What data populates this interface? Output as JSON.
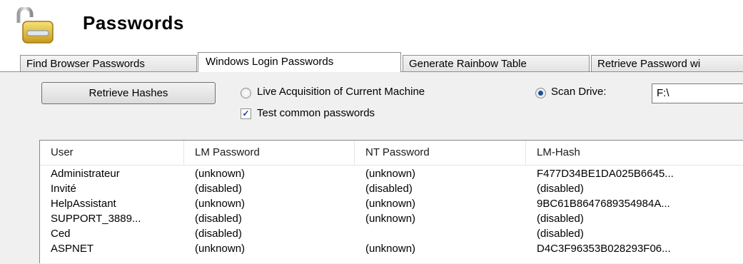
{
  "header": {
    "title": "Passwords",
    "icon": "padlock-icon"
  },
  "tabs": [
    {
      "label": "Find Browser Passwords",
      "active": false
    },
    {
      "label": "Windows Login Passwords",
      "active": true
    },
    {
      "label": "Generate Rainbow Table",
      "active": false
    },
    {
      "label": "Retrieve Password wi",
      "active": false
    }
  ],
  "controls": {
    "retrieve_button": "Retrieve Hashes",
    "live_radio": {
      "label": "Live Acquisition of Current Machine",
      "checked": false
    },
    "scan_radio": {
      "label": "Scan Drive:",
      "checked": true
    },
    "drive_value": "F:\\",
    "test_common": {
      "label": "Test common passwords",
      "checked": true
    }
  },
  "table": {
    "columns": [
      "User",
      "LM Password",
      "NT Password",
      "LM-Hash"
    ],
    "rows": [
      [
        "Administrateur",
        "(unknown)",
        "(unknown)",
        "F477D34BE1DA025B6645..."
      ],
      [
        "Invité",
        "(disabled)",
        "(disabled)",
        "(disabled)"
      ],
      [
        "HelpAssistant",
        "(unknown)",
        "(unknown)",
        "9BC61B8647689354984A..."
      ],
      [
        "SUPPORT_3889...",
        "(disabled)",
        "(unknown)",
        "(disabled)"
      ],
      [
        "Ced",
        "(disabled)",
        "",
        "(disabled)"
      ],
      [
        "ASPNET",
        "(unknown)",
        "(unknown)",
        "D4C3F96353B028293F06..."
      ]
    ]
  },
  "colors": {
    "accent": "#1b4f9c",
    "border": "#8e8f8f",
    "panel": "#f0f0f0"
  }
}
